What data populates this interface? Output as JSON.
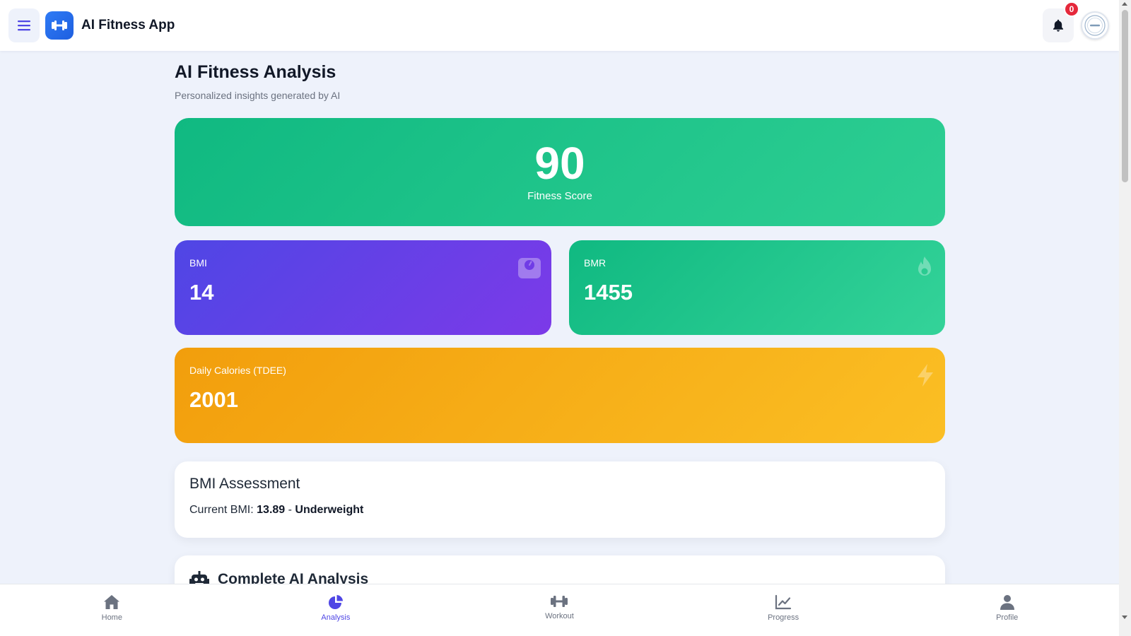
{
  "header": {
    "app_title": "AI Fitness App",
    "notification_count": "0",
    "menu_icon": "hamburger-menu-icon",
    "logo_icon": "dumbbell-icon",
    "bell_icon": "bell-icon"
  },
  "page": {
    "title": "AI Fitness Analysis",
    "subtitle": "Personalized insights generated by AI"
  },
  "fitness_score": {
    "value": "90",
    "label": "Fitness Score"
  },
  "stats": {
    "bmi": {
      "label": "BMI",
      "value": "14",
      "icon": "weight-scale-icon"
    },
    "bmr": {
      "label": "BMR",
      "value": "1455",
      "icon": "fire-icon"
    },
    "tdee": {
      "label": "Daily Calories (TDEE)",
      "value": "2001",
      "icon": "lightning-icon"
    }
  },
  "bmi_assessment": {
    "title": "BMI Assessment",
    "prefix": "Current BMI:",
    "value": "13.89",
    "separator": "-",
    "category": "Underweight"
  },
  "analysis": {
    "title": "Complete AI Analysis",
    "icon": "robot-icon"
  },
  "bottom_nav": {
    "items": [
      {
        "label": "Home",
        "icon": "home-icon"
      },
      {
        "label": "Analysis",
        "icon": "pie-chart-icon",
        "active": true
      },
      {
        "label": "Workout",
        "icon": "dumbbell-icon"
      },
      {
        "label": "Progress",
        "icon": "line-chart-icon"
      },
      {
        "label": "Profile",
        "icon": "user-icon"
      }
    ]
  },
  "colors": {
    "accent": "#4f46e5",
    "score_green": "#10b981",
    "bmi_purple": "#7c3ae8",
    "tdee_orange": "#f59e0b",
    "badge_red": "#e5283b"
  }
}
